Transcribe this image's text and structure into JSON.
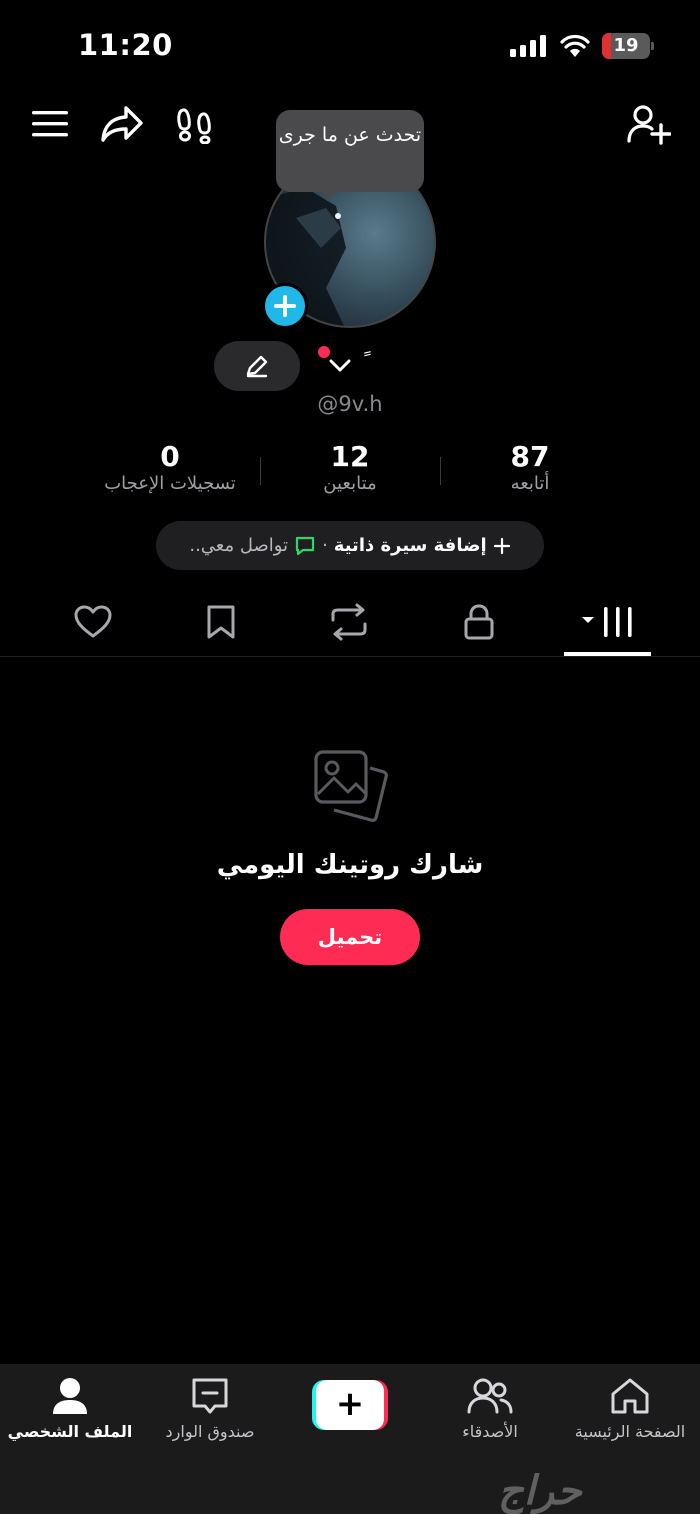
{
  "status_bar": {
    "time": "11:20",
    "battery": "19",
    "battery_level": 0.19
  },
  "header": {
    "menu_icon": "hamburger-menu-icon",
    "share_icon": "share-arrow-icon",
    "footprints_icon": "footprints-icon",
    "add_friend_icon": "add-user-icon"
  },
  "profile": {
    "tooltip": "تحدث عن ما جرى",
    "handle": "@9v.h",
    "name_mark": "ٍ",
    "stats": [
      {
        "value": "87",
        "label": "أتابعه"
      },
      {
        "value": "12",
        "label": "متابعين"
      },
      {
        "value": "0",
        "label": "تسجيلات الإعجاب"
      }
    ],
    "bio_add": "إضافة سيرة ذاتية",
    "bio_sep": "·",
    "bio_contact": "تواصل معي.."
  },
  "tabs": [
    "videos-grid",
    "private",
    "reposts",
    "saved",
    "liked"
  ],
  "empty_state": {
    "title": "شارك روتينك اليومي",
    "button": "تحميل"
  },
  "bottom_nav": {
    "home": "الصفحة الرئيسية",
    "friends": "الأصدقاء",
    "create": "+",
    "inbox": "صندوق الوارد",
    "profile": "الملف الشخصي"
  },
  "watermark": "حراج",
  "colors": {
    "accent": "#fe2c55",
    "cyan": "#25f4ee",
    "plus_blue": "#20b8e8",
    "green": "#2bd96b"
  }
}
